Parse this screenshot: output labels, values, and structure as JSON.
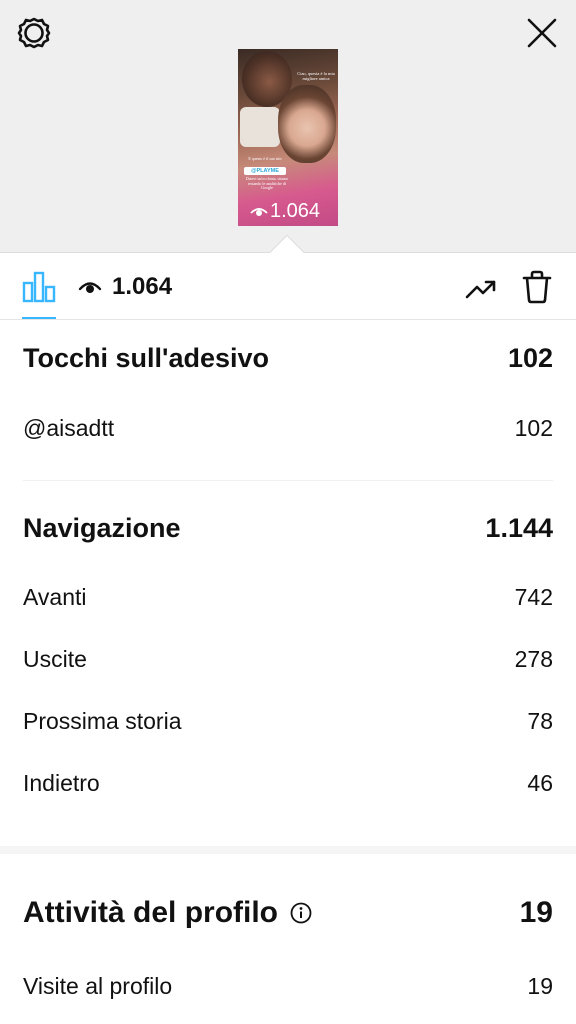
{
  "header": {
    "settings_icon": "gear-icon",
    "close_icon": "close-icon"
  },
  "story_preview": {
    "caption_top": "Ciao, questa è la mia migliore amica",
    "caption_middle": "E questo è il suo sito",
    "sticker_text": "@PLAYME",
    "caption_bottom": "Datevi un'occhiata, stiamo testando le analitiche di Google",
    "views": "1.064"
  },
  "toolbar": {
    "insights_icon": "bar-chart-icon",
    "views_icon": "eye-icon",
    "views": "1.064",
    "promote_icon": "trending-up-icon",
    "delete_icon": "trash-icon",
    "accent": "#38b6ff"
  },
  "sticker_taps": {
    "title": "Tocchi sull'adesivo",
    "total": "102",
    "items": [
      {
        "label": "@aisadtt",
        "value": "102"
      }
    ]
  },
  "navigation": {
    "title": "Navigazione",
    "total": "1.144",
    "items": [
      {
        "label": "Avanti",
        "value": "742"
      },
      {
        "label": "Uscite",
        "value": "278"
      },
      {
        "label": "Prossima storia",
        "value": "78"
      },
      {
        "label": "Indietro",
        "value": "46"
      }
    ]
  },
  "profile_activity": {
    "title": "Attività del profilo",
    "total": "19",
    "info_icon": "info-icon",
    "items": [
      {
        "label": "Visite al profilo",
        "value": "19"
      }
    ]
  }
}
